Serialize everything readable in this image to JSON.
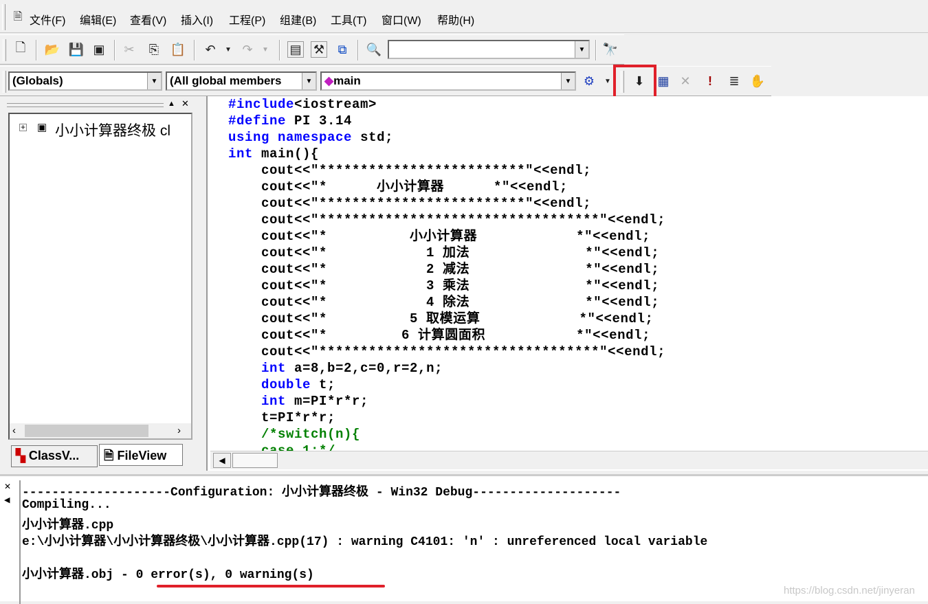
{
  "menu": [
    "文件(F)",
    "编辑(E)",
    "查看(V)",
    "插入(I)",
    "工程(P)",
    "组建(B)",
    "工具(T)",
    "窗口(W)",
    "帮助(H)"
  ],
  "combos": {
    "scope": "(Globals)",
    "members": "(All global members",
    "function": "main",
    "find": ""
  },
  "tree": {
    "root": "小小计算器终极 cl"
  },
  "tabs": [
    "ClassV...",
    "FileView"
  ],
  "code": [
    [
      [
        "kw",
        "#include"
      ],
      [
        "t",
        "<iostream>"
      ]
    ],
    [
      [
        "kw",
        "#define"
      ],
      [
        "t",
        " PI 3.14"
      ]
    ],
    [
      [
        "kw",
        "using"
      ],
      [
        "t",
        " "
      ],
      [
        "kw",
        "namespace"
      ],
      [
        "t",
        " std;"
      ]
    ],
    [
      [
        "kw",
        "int"
      ],
      [
        "t",
        " main(){"
      ]
    ],
    [
      [
        "t",
        "    cout<<\"*************************\"<<endl;"
      ]
    ],
    [
      [
        "t",
        "    cout<<\"*      小小计算器      *\"<<endl;"
      ]
    ],
    [
      [
        "t",
        "    cout<<\"*************************\"<<endl;"
      ]
    ],
    [
      [
        "t",
        "    cout<<\"**********************************\"<<endl;"
      ]
    ],
    [
      [
        "t",
        "    cout<<\"*          小小计算器            *\"<<endl;"
      ]
    ],
    [
      [
        "t",
        "    cout<<\"*            1 加法              *\"<<endl;"
      ]
    ],
    [
      [
        "t",
        "    cout<<\"*            2 减法              *\"<<endl;"
      ]
    ],
    [
      [
        "t",
        "    cout<<\"*            3 乘法              *\"<<endl;"
      ]
    ],
    [
      [
        "t",
        "    cout<<\"*            4 除法              *\"<<endl;"
      ]
    ],
    [
      [
        "t",
        "    cout<<\"*          5 取模运算            *\"<<endl;"
      ]
    ],
    [
      [
        "t",
        "    cout<<\"*         6 计算圆面积           *\"<<endl;"
      ]
    ],
    [
      [
        "t",
        "    cout<<\"**********************************\"<<endl;"
      ]
    ],
    [
      [
        "t",
        "    "
      ],
      [
        "kw",
        "int"
      ],
      [
        "t",
        " a=8,b=2,c=0,r=2,n;"
      ]
    ],
    [
      [
        "t",
        "    "
      ],
      [
        "kw",
        "double"
      ],
      [
        "t",
        " t;"
      ]
    ],
    [
      [
        "t",
        "    "
      ],
      [
        "kw",
        "int"
      ],
      [
        "t",
        " m=PI*r*r;"
      ]
    ],
    [
      [
        "t",
        "    t=PI*r*r;"
      ]
    ],
    [
      [
        "cm",
        "    /*switch(n){"
      ]
    ],
    [
      [
        "cm",
        "    case 1:*/"
      ]
    ]
  ],
  "output": [
    "--------------------Configuration: 小小计算器终极 - Win32 Debug--------------------",
    "Compiling...",
    "小小计算器.cpp",
    "e:\\小小计算器\\小小计算器终极\\小小计算器.cpp(17) : warning C4101: 'n' : unreferenced local variable",
    "",
    "小小计算器.obj - 0 error(s), 0 warning(s)"
  ],
  "watermark": "https://blog.csdn.net/jinyeran",
  "colors": {
    "keyword": "#0000ff",
    "comment": "#008000",
    "highlight": "#e0202a"
  }
}
